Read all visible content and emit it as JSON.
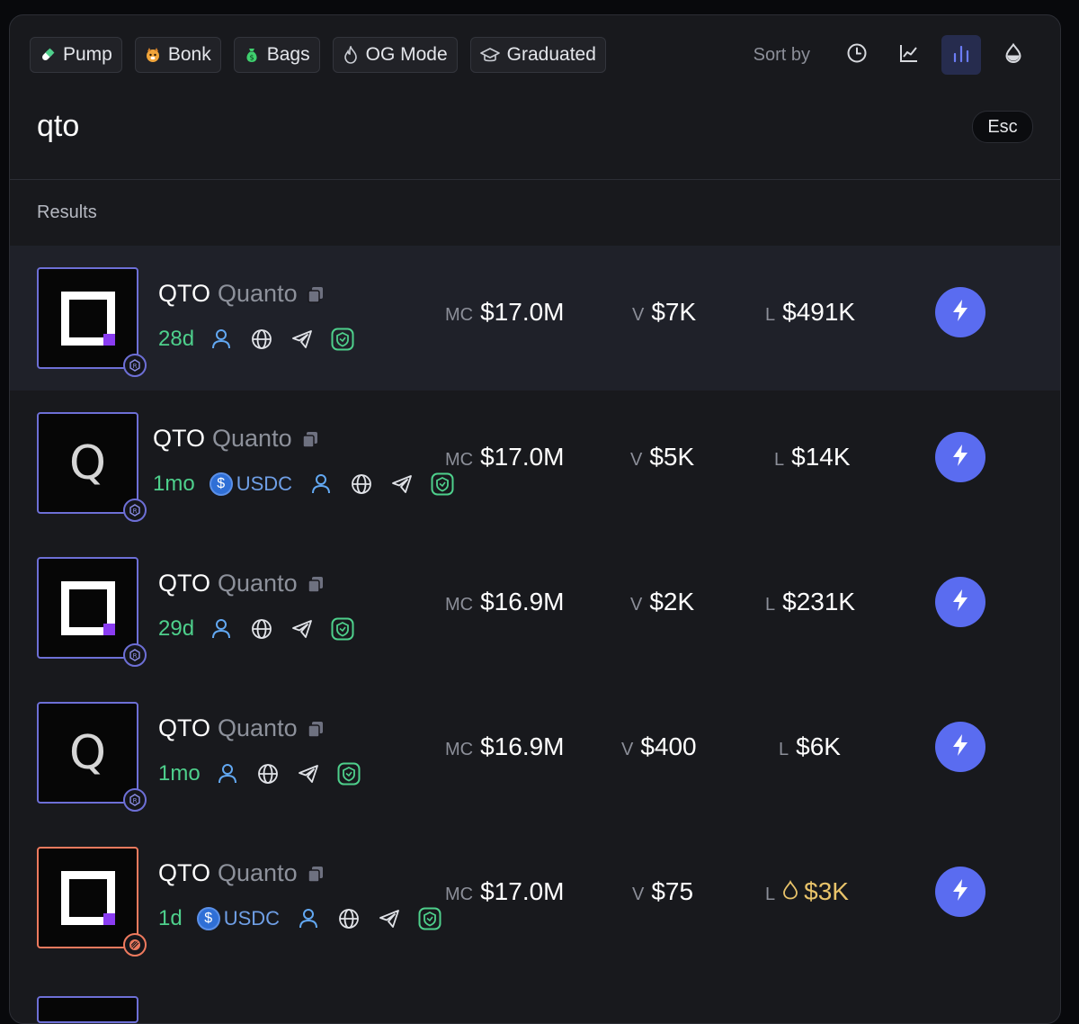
{
  "filters": [
    {
      "label": "Pump",
      "icon": "pill-icon"
    },
    {
      "label": "Bonk",
      "icon": "bonk-dog-icon"
    },
    {
      "label": "Bags",
      "icon": "money-bag-icon"
    },
    {
      "label": "OG Mode",
      "icon": "flame-icon"
    },
    {
      "label": "Graduated",
      "icon": "graduation-cap-icon"
    }
  ],
  "sort": {
    "label": "Sort by",
    "options": [
      "clock-icon",
      "chart-line-icon",
      "bar-chart-icon",
      "liquidity-drop-icon"
    ],
    "active": "bar-chart-icon"
  },
  "search": {
    "query": "qto",
    "esc_label": "Esc"
  },
  "results_label": "Results",
  "labels": {
    "mc": "MC",
    "v": "V",
    "l": "L"
  },
  "rows": [
    {
      "symbol": "QTO",
      "name": "Quanto",
      "age": "28d",
      "quote": "",
      "mc": "$17.0M",
      "v": "$7K",
      "l": "$491K",
      "logo": "square",
      "highlight": true
    },
    {
      "symbol": "QTO",
      "name": "Quanto",
      "age": "1mo",
      "quote": "USDC",
      "mc": "$17.0M",
      "v": "$5K",
      "l": "$14K",
      "logo": "q",
      "highlight": false
    },
    {
      "symbol": "QTO",
      "name": "Quanto",
      "age": "29d",
      "quote": "",
      "mc": "$16.9M",
      "v": "$2K",
      "l": "$231K",
      "logo": "square",
      "highlight": false
    },
    {
      "symbol": "QTO",
      "name": "Quanto",
      "age": "1mo",
      "quote": "",
      "mc": "$16.9M",
      "v": "$400",
      "l": "$6K",
      "logo": "q",
      "highlight": false
    },
    {
      "symbol": "QTO",
      "name": "Quanto",
      "age": "1d",
      "quote": "USDC",
      "mc": "$17.0M",
      "v": "$75",
      "l": "$3K",
      "logo": "square",
      "highlight": false,
      "low_liquidity": true
    }
  ],
  "colors": {
    "accent": "#5a6cf0",
    "age": "#4ed08c",
    "usdc": "#6f9fe6",
    "warning": "#e8c36a"
  }
}
